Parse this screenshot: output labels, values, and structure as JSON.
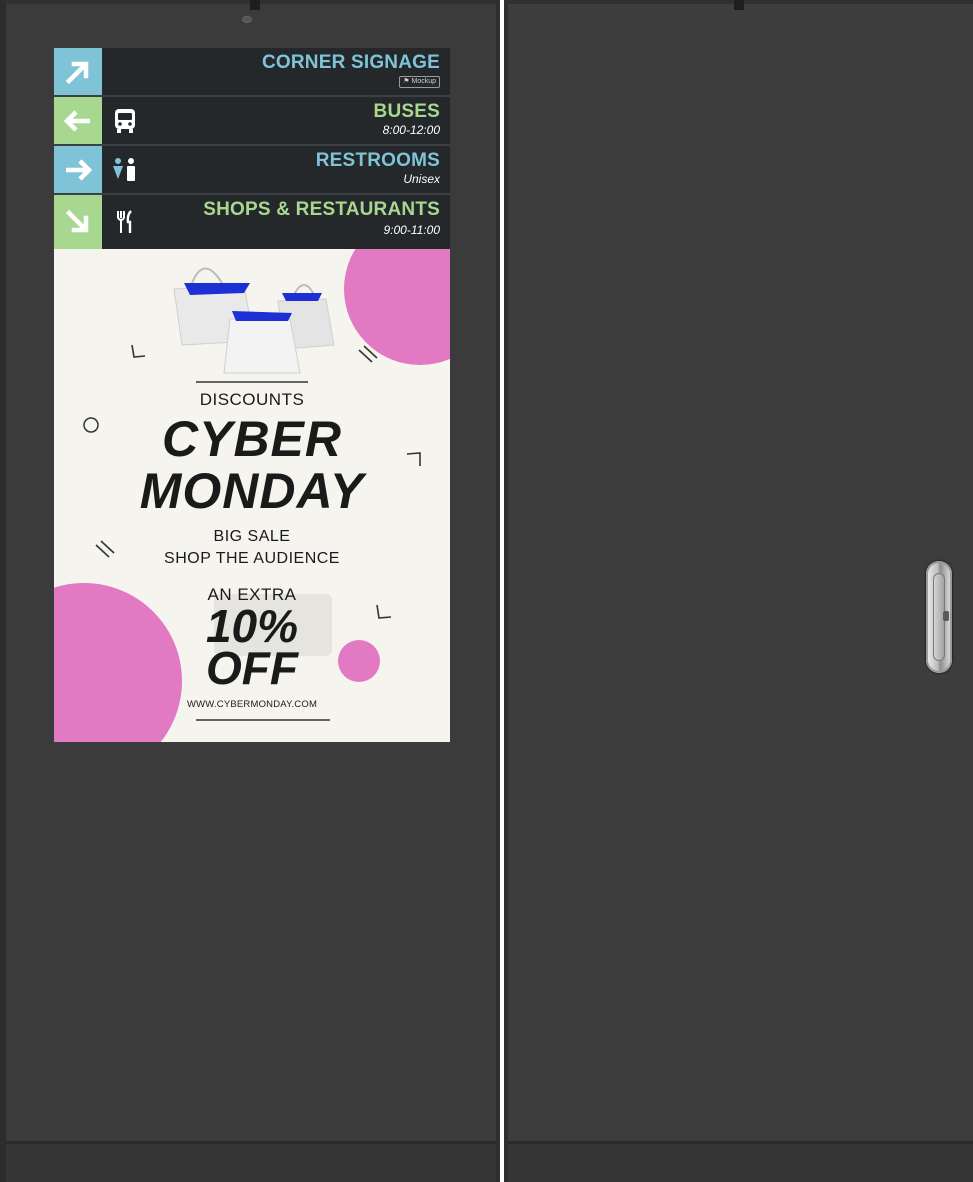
{
  "signage": {
    "rows": [
      {
        "title": "CORNER SIGNAGE",
        "subtitle": "",
        "badge": "Mockup",
        "title_color": "#7fc4d6",
        "arrow_bg": "#7fc4d6",
        "arrow": "northeast-arrow-icon",
        "symbol": ""
      },
      {
        "title": "BUSES",
        "subtitle": "8:00-12:00",
        "title_color": "#a8d890",
        "arrow_bg": "#a8d890",
        "arrow": "left-arrow-icon",
        "symbol": "bus-icon"
      },
      {
        "title": "RESTROOMS",
        "subtitle": "Unisex",
        "title_color": "#7fc4d6",
        "arrow_bg": "#7fc4d6",
        "arrow": "right-arrow-icon",
        "symbol": "restroom-icon"
      },
      {
        "title": "SHOPS & RESTAURANTS",
        "subtitle": "9:00-11:00",
        "title_color": "#a8d890",
        "arrow_bg": "#a8d890",
        "arrow": "southeast-arrow-icon",
        "symbol": "fork-knife-icon"
      }
    ]
  },
  "poster": {
    "discounts": "DISCOUNTS",
    "headline_1": "CYBER",
    "headline_2": "MONDAY",
    "line_1": "BIG SALE",
    "line_2": "SHOP THE AUDIENCE",
    "extra": "AN EXTRA",
    "percent": "10%",
    "off": "OFF",
    "url": "WWW.CYBERMONDAY.COM",
    "accent_color": "#e27ac3",
    "bag_accent": "#1f2fd6"
  },
  "colors": {
    "cabinet": "#3b3b3b",
    "screen_bg": "#f6f4ee",
    "panel_bg": "#24282b"
  }
}
